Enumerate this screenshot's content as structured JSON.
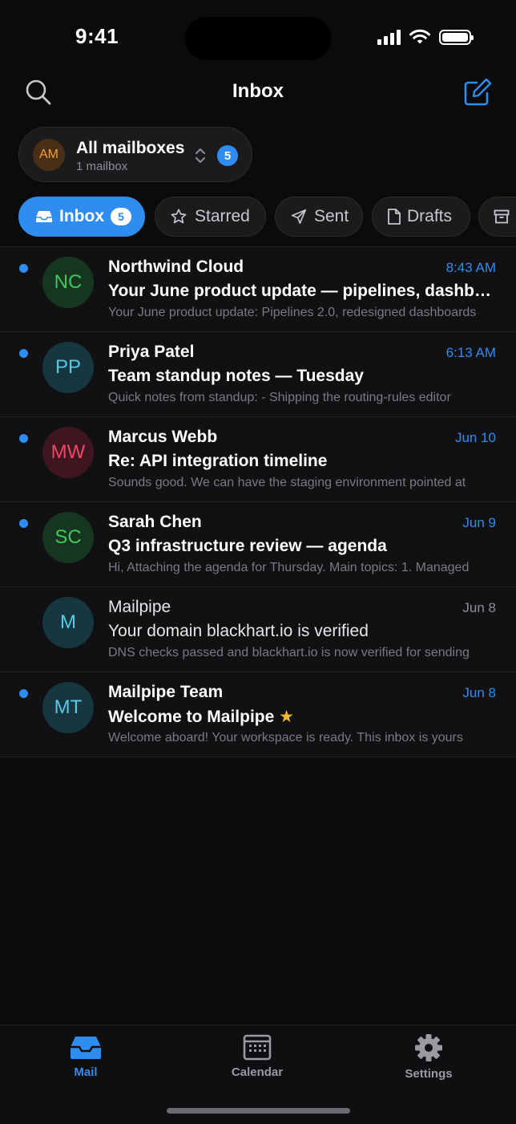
{
  "status_bar": {
    "time": "9:41"
  },
  "header": {
    "title": "Inbox"
  },
  "mailbox_switcher": {
    "avatar_initials": "AM",
    "title": "All mailboxes",
    "subtitle": "1 mailbox",
    "badge": "5"
  },
  "tabs": [
    {
      "label": "Inbox",
      "badge": "5",
      "icon": "inbox-icon",
      "active": true
    },
    {
      "label": "Starred",
      "icon": "star-icon"
    },
    {
      "label": "Sent",
      "icon": "send-icon"
    },
    {
      "label": "Drafts",
      "icon": "draft-icon"
    },
    {
      "label": "",
      "icon": "archive-icon"
    }
  ],
  "messages": [
    {
      "initials": "NC",
      "sender": "Northwind Cloud",
      "date": "8:43 AM",
      "subject": "Your June product update — pipelines, dashboards",
      "preview": "Your June product update: Pipelines 2.0, redesigned dashboards",
      "unread": true,
      "avatar_bg": "#17361f",
      "avatar_fg": "#3fc860"
    },
    {
      "initials": "PP",
      "sender": "Priya Patel",
      "date": "6:13 AM",
      "subject": "Team standup notes — Tuesday",
      "preview": "Quick notes from standup: - Shipping the routing-rules editor",
      "unread": true,
      "avatar_bg": "#163640",
      "avatar_fg": "#5ac8e8"
    },
    {
      "initials": "MW",
      "sender": "Marcus Webb",
      "date": "Jun 10",
      "subject": "Re: API integration timeline",
      "preview": "Sounds good. We can have the staging environment pointed at",
      "unread": true,
      "avatar_bg": "#3e1620",
      "avatar_fg": "#ee4866"
    },
    {
      "initials": "SC",
      "sender": "Sarah Chen",
      "date": "Jun 9",
      "subject": "Q3 infrastructure review — agenda",
      "preview": "Hi, Attaching the agenda for Thursday. Main topics: 1. Managed",
      "unread": true,
      "avatar_bg": "#17361f",
      "avatar_fg": "#3fc860"
    },
    {
      "initials": "M",
      "sender": "Mailpipe",
      "date": "Jun 8",
      "subject": "Your domain blackhart.io is verified",
      "preview": "DNS checks passed and blackhart.io is now verified for sending",
      "unread": false,
      "avatar_bg": "#163640",
      "avatar_fg": "#5ac8e8"
    },
    {
      "initials": "MT",
      "sender": "Mailpipe Team",
      "date": "Jun 8",
      "subject": "Welcome to Mailpipe",
      "subject_star": "★",
      "preview": "Welcome aboard! Your workspace is ready. This inbox is yours",
      "unread": true,
      "avatar_bg": "#163640",
      "avatar_fg": "#5ac8e8"
    }
  ],
  "bottom_nav": [
    {
      "label": "Mail",
      "icon": "mail-tray-icon",
      "active": true
    },
    {
      "label": "Calendar",
      "icon": "calendar-icon"
    },
    {
      "label": "Settings",
      "icon": "gear-icon"
    }
  ],
  "colors": {
    "accent": "#2f8cf0",
    "background": "#0b0b0c",
    "star": "#f5b82e"
  }
}
